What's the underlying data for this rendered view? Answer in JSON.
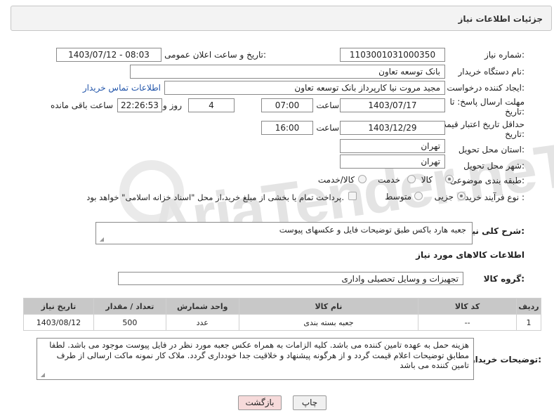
{
  "header": {
    "title": "جزئیات اطلاعات نیاز"
  },
  "labels": {
    "need_number": "شماره نیاز:",
    "announce_datetime": "تاریخ و ساعت اعلان عمومی:",
    "buyer_org": "نام دستگاه خریدار:",
    "requester": "ایجاد کننده درخواست:",
    "reply_deadline_l1": "مهلت ارسال پاسخ: تا",
    "reply_deadline_l2": "تاریخ:",
    "price_validity_l1": "حداقل تاریخ اعتبار قیمت: تا",
    "price_validity_l2": "تاریخ:",
    "hour": "ساعت",
    "hour2": "ساعت",
    "day_and": "روز و",
    "remaining": "ساعت باقی مانده",
    "province": "استان محل تحویل:",
    "city": "شهر محل تحویل:",
    "category": "طبقه بندی موضوعی:",
    "purchase_type": "نوع فرآیند خرید :",
    "overall_desc": "شرح کلی نیاز:",
    "goods_info": "اطلاعات کالاهای مورد نیاز",
    "goods_group": "گروه کالا:",
    "buyer_notes": "توضیحات خریدار:"
  },
  "values": {
    "need_number": "1103001031000350",
    "announce_datetime": "1403/07/12 - 08:03",
    "buyer_org": "بانک توسعه تعاون",
    "requester": "مجید مروت نیا کارپرداز بانک توسعه تعاون",
    "contact_link": "اطلاعات تماس خریدار",
    "reply_date": "1403/07/17",
    "reply_time": "07:00",
    "reply_days": "4",
    "reply_remaining": "22:26:53",
    "validity_date": "1403/12/29",
    "validity_time": "16:00",
    "province": "تهران",
    "city": "تهران",
    "overall_desc": "جعبه هارد باکس طبق توضیحات فایل و عکسهای پیوست",
    "goods_group": "تجهیزات و وسایل تحصیلی واداری",
    "buyer_notes": "هزینه حمل به عهده تامین کننده می باشد. کلیه الزامات به همراه عکس جعبه مورد نظر در فایل پیوست موجود می باشد. لطفا مطابق توضیحات اعلام قیمت گردد و از هرگونه پیشنهاد و خلاقیت جدا خودداری گردد. ملاک کار نمونه ماکت ارسالی از طرف تامین کننده می باشد"
  },
  "category_options": [
    {
      "label": "کالا",
      "selected": true
    },
    {
      "label": "خدمت",
      "selected": false
    },
    {
      "label": "کالا/خدمت",
      "selected": false
    }
  ],
  "purchase_options": [
    {
      "label": "جزیی",
      "selected": true
    },
    {
      "label": "متوسط",
      "selected": false
    }
  ],
  "treasury_note": "پرداخت تمام یا بخشی از مبلغ خرید،از محل \"اسناد خزانه اسلامی\" خواهد بود.",
  "watermark": "AriaTender.neT",
  "table": {
    "headers": [
      "ردیف",
      "کد کالا",
      "نام کالا",
      "واحد شمارش",
      "تعداد / مقدار",
      "تاریخ نیاز"
    ],
    "rows": [
      [
        "1",
        "--",
        "جعبه بسته بندی",
        "عدد",
        "500",
        "1403/08/12"
      ]
    ]
  },
  "buttons": {
    "print": "چاپ",
    "back": "بازگشت"
  },
  "colors": {
    "link": "#2255aa",
    "back_button_bg": "#f6dada",
    "table_header_bg": "#c8c8c8"
  }
}
